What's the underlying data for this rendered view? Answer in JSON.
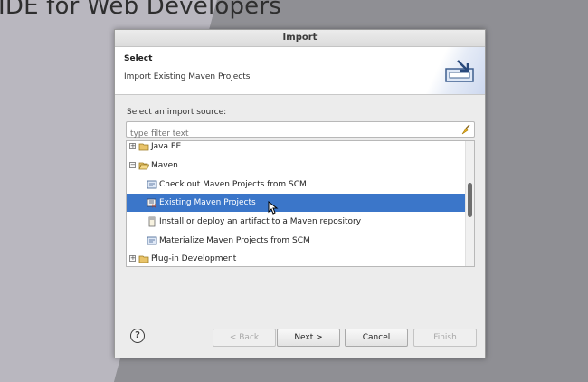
{
  "background": {
    "title": "IDE for Web Developers"
  },
  "dialog": {
    "title": "Import",
    "header": {
      "title": "Select",
      "description": "Import Existing Maven Projects"
    },
    "source_label": "Select an import source:",
    "filter": {
      "placeholder": "type filter text",
      "value": ""
    },
    "tree": {
      "items": [
        {
          "label": "Java EE",
          "type": "folder",
          "expanded": false
        },
        {
          "label": "Maven",
          "type": "folder",
          "expanded": true
        },
        {
          "label": "Check out Maven Projects from SCM",
          "type": "wizard"
        },
        {
          "label": "Existing Maven Projects",
          "type": "wizard",
          "selected": true
        },
        {
          "label": "Install or deploy an artifact to a Maven repository",
          "type": "wizard"
        },
        {
          "label": "Materialize Maven Projects from SCM",
          "type": "wizard"
        },
        {
          "label": "Plug-in Development",
          "type": "folder",
          "expanded": false
        }
      ]
    },
    "buttons": {
      "back": "< Back",
      "next": "Next >",
      "cancel": "Cancel",
      "finish": "Finish",
      "help": "?"
    }
  },
  "colors": {
    "selection": "#3b76c9",
    "background": "#8f8f94"
  }
}
